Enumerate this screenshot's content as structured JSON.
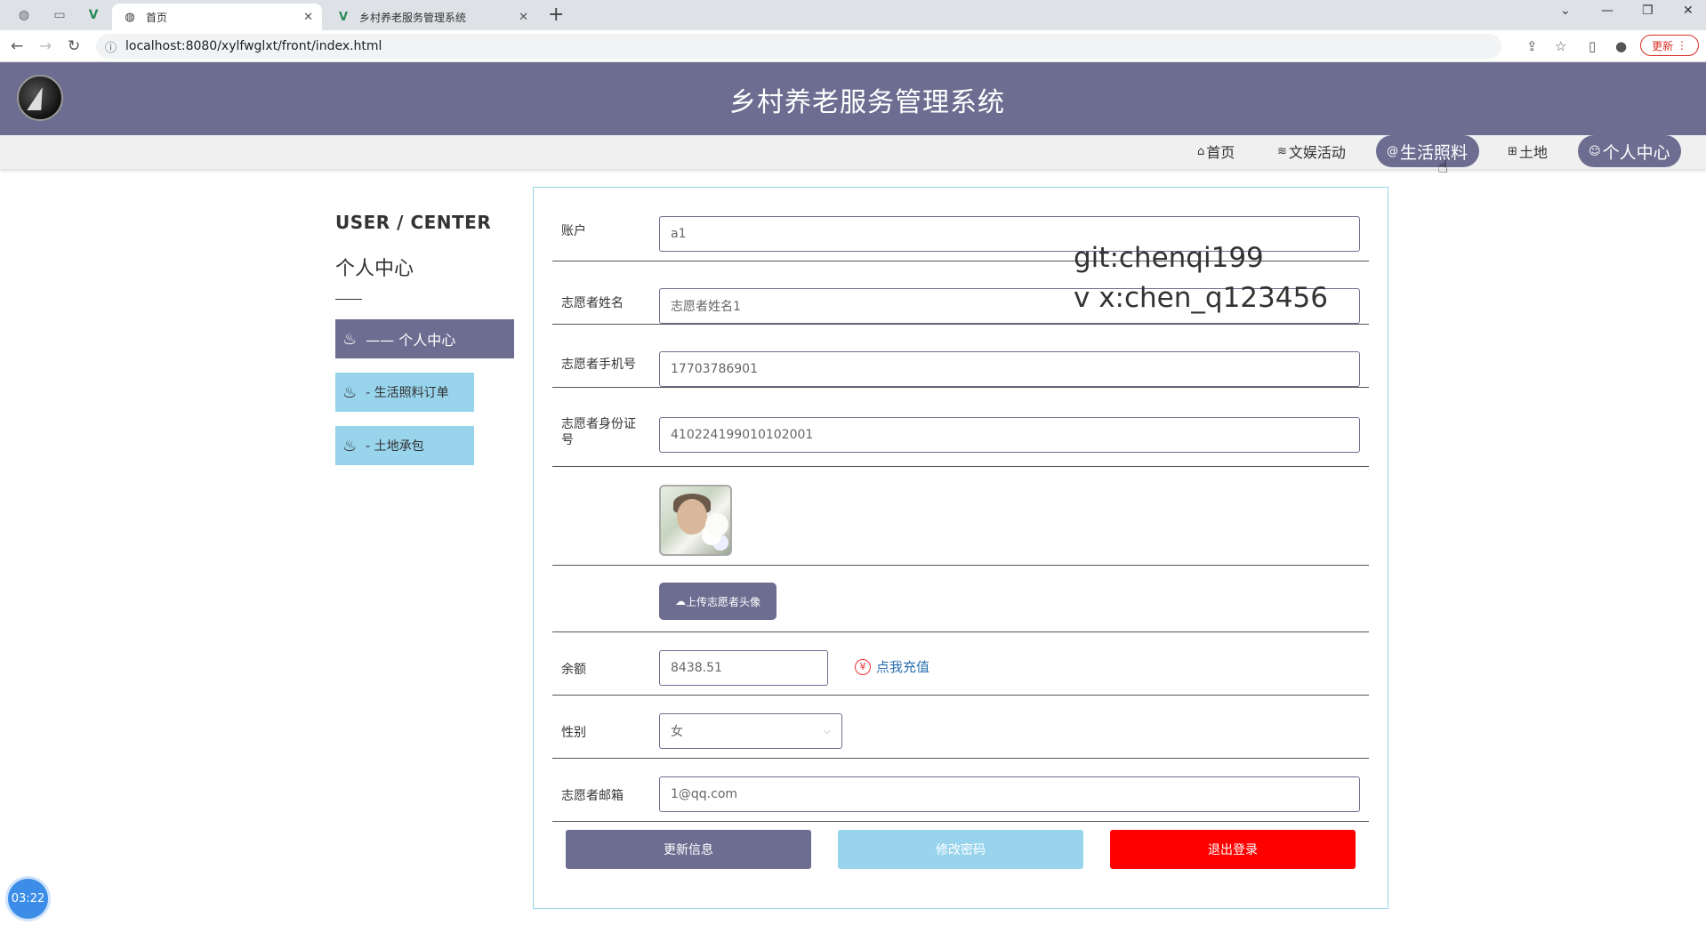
{
  "browser": {
    "tabs": [
      {
        "title": "首页",
        "active": true
      },
      {
        "title": "乡村养老服务管理系统",
        "active": false
      }
    ],
    "url": "localhost:8080/xylfwglxt/front/index.html",
    "update_label": "更新"
  },
  "header": {
    "title": "乡村养老服务管理系统"
  },
  "menu": {
    "items": [
      {
        "label": "首页",
        "icon": "home-icon"
      },
      {
        "label": "文娱活动",
        "icon": "layers-icon"
      },
      {
        "label": "生活照料",
        "icon": "care-icon",
        "highlighted": true
      },
      {
        "label": "土地",
        "icon": "grid-icon"
      },
      {
        "label": "个人中心",
        "icon": "user-icon",
        "highlighted": true
      }
    ]
  },
  "sidebar": {
    "title_en": "USER / CENTER",
    "title_cn": "个人中心",
    "items": [
      {
        "label": "—— 个人中心",
        "active": true
      },
      {
        "label": "- 生活照料订单",
        "active": false
      },
      {
        "label": "- 土地承包",
        "active": false
      }
    ]
  },
  "form": {
    "account": {
      "label": "账户",
      "value": "a1"
    },
    "name": {
      "label": "志愿者姓名",
      "value": "志愿者姓名1"
    },
    "phone": {
      "label": "志愿者手机号",
      "value": "17703786901"
    },
    "id_number": {
      "label": "志愿者身份证号",
      "value": "410224199010102001"
    },
    "upload_label": "上传志愿者头像",
    "balance": {
      "label": "余额",
      "value": "8438.51"
    },
    "recharge_label": "点我充值",
    "gender": {
      "label": "性别",
      "value": "女"
    },
    "email": {
      "label": "志愿者邮箱",
      "value": "1@qq.com"
    },
    "buttons": {
      "update": "更新信息",
      "change_password": "修改密码",
      "logout": "退出登录"
    }
  },
  "watermark": {
    "line1": "git:chenqi199",
    "line2": "v x:chen_q123456"
  },
  "clock": "03:22",
  "colors": {
    "primary": "#6d6d91",
    "light_blue": "#98d4ec",
    "danger": "#ff0000"
  }
}
